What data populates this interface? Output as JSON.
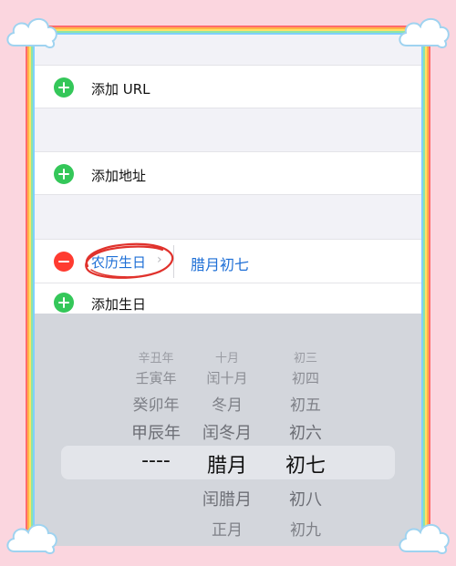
{
  "rows": {
    "add_url": "添加 URL",
    "add_address": "添加地址",
    "lunar_birthday_label": "农历生日",
    "lunar_birthday_value": "腊月初七",
    "add_birthday": "添加生日"
  },
  "picker": {
    "year": [
      "辛丑年",
      "壬寅年",
      "癸卯年",
      "甲辰年",
      "----",
      "",
      ""
    ],
    "month": [
      "十月",
      "闰十月",
      "冬月",
      "闰冬月",
      "腊月",
      "闰腊月",
      "正月"
    ],
    "day": [
      "初三",
      "初四",
      "初五",
      "初六",
      "初七",
      "初八",
      "初九"
    ],
    "selected_index": 4
  },
  "colors": {
    "add_icon": "#34c759",
    "remove_icon": "#ff3b30",
    "link_blue": "#1e6fd6",
    "highlight_circle": "#e0322c"
  }
}
